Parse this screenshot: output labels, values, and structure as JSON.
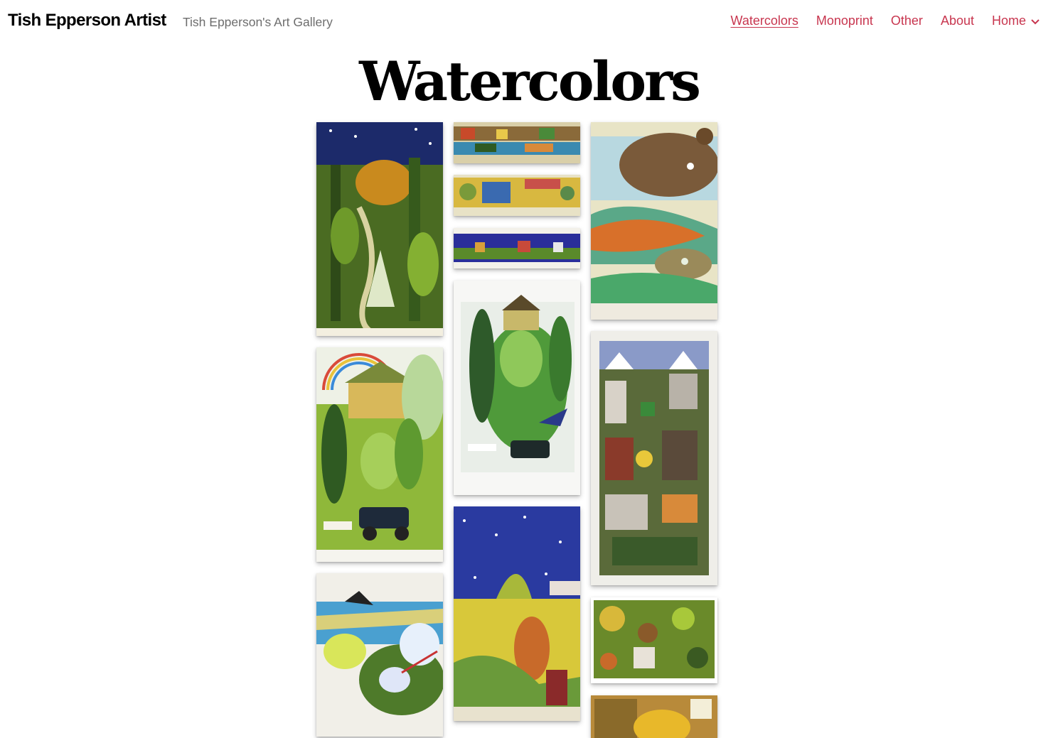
{
  "site": {
    "title": "Tish Epperson Artist",
    "tagline": "Tish Epperson's Art Gallery"
  },
  "nav": {
    "items": [
      {
        "label": "Watercolors",
        "active": true
      },
      {
        "label": "Monoprint",
        "active": false
      },
      {
        "label": "Other",
        "active": false
      },
      {
        "label": "About",
        "active": false
      },
      {
        "label": "Home",
        "active": false,
        "has_submenu": true,
        "icon": "chevron-down-icon"
      }
    ],
    "link_color": "#c8364f"
  },
  "page": {
    "title": "Watercolors"
  }
}
